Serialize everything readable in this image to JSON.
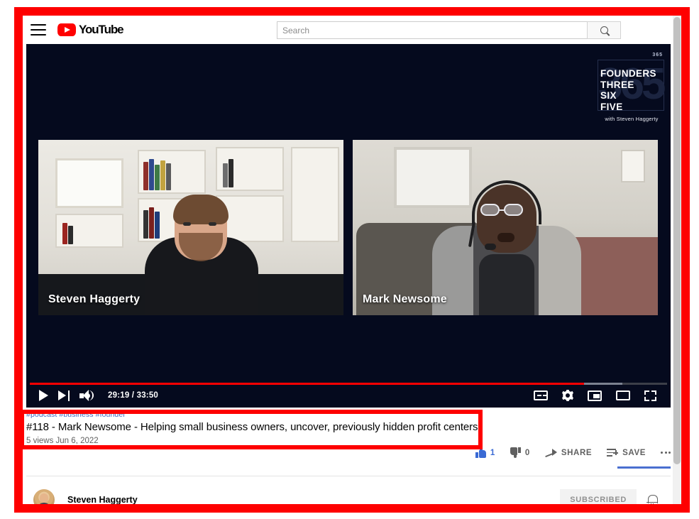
{
  "masthead": {
    "menu_icon": "hamburger-menu-icon",
    "logo_text": "YouTube",
    "search": {
      "placeholder": "Search",
      "value": "",
      "button_icon": "search-icon"
    }
  },
  "player": {
    "watermark": {
      "number": "365",
      "ghost": "365",
      "line1": "FOUNDERS",
      "line2": "THREE",
      "line3": "SIX",
      "line4": "FIVE",
      "subtitle": "with Steven Haggerty"
    },
    "participants": [
      {
        "name": "Steven Haggerty"
      },
      {
        "name": "Mark Newsome"
      }
    ],
    "controls": {
      "play_icon": "play-icon",
      "next_icon": "next-video-icon",
      "volume_icon": "volume-icon",
      "time_current": "29:19",
      "time_separator": " / ",
      "time_total": "33:50",
      "time_display": "29:19 / 33:50",
      "captions_icon": "closed-captions-icon",
      "settings_icon": "gear-icon",
      "miniplayer_icon": "miniplayer-icon",
      "theater_icon": "theater-mode-icon",
      "fullscreen_icon": "fullscreen-icon"
    },
    "progress": {
      "played_percent": 87,
      "buffered_percent": 93,
      "played_color": "#ff0000",
      "buffer_color": "#7b8190",
      "track_color": "#3c3f49"
    }
  },
  "info": {
    "hashtags": [
      "#podcast",
      "#business",
      "#founder"
    ],
    "hashtag_line": "#podcast #business #founder",
    "title": "#118 - Mark Newsome - Helping small business owners, uncover, previously hidden profit centers",
    "views_date": "5 views  Jun 6, 2022",
    "actions": {
      "like_label": "1",
      "dislike_label": "0",
      "share_label": "SHARE",
      "save_label": "SAVE",
      "more_label": "more-actions",
      "like_icon": "thumbs-up-icon",
      "dislike_icon": "thumbs-down-icon",
      "share_icon": "share-arrow-icon",
      "save_icon": "save-to-playlist-icon",
      "more_icon": "more-horizontal-icon",
      "like_active_color": "#3a6ad4"
    }
  },
  "channel": {
    "avatar_icon": "channel-avatar",
    "name": "Steven Haggerty",
    "subscribe_label": "SUBSCRIBED",
    "bell_icon": "notification-bell-icon"
  },
  "annotation": {
    "frame_color": "#fe0000",
    "title_box_color": "#fe0000"
  }
}
